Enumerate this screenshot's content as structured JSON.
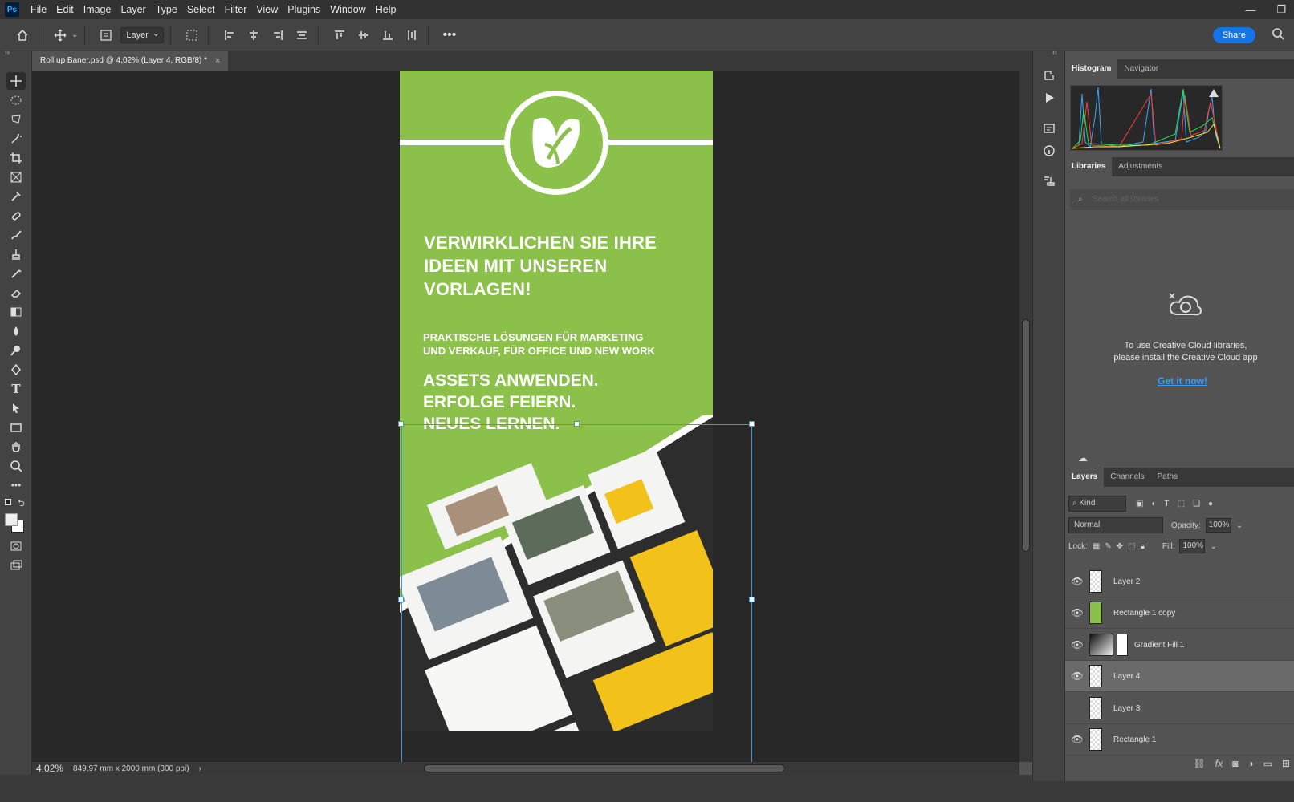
{
  "menu": {
    "app_logo": "Ps",
    "items": [
      "File",
      "Edit",
      "Image",
      "Layer",
      "Type",
      "Select",
      "Filter",
      "View",
      "Plugins",
      "Window",
      "Help"
    ]
  },
  "options": {
    "auto_select_target": "Layer",
    "share_label": "Share"
  },
  "document_tab": {
    "title": "Roll up Baner.psd @ 4,02% (Layer 4, RGB/8) *",
    "close": "×"
  },
  "artwork": {
    "headline": [
      "VERWIRKLICHEN SIE IHRE",
      "IDEEN MIT UNSEREN",
      "VORLAGEN!"
    ],
    "subline": [
      "PRAKTISCHE LÖSUNGEN FÜR MARKETING",
      "UND VERKAUF, FÜR OFFICE UND NEW WORK"
    ],
    "tagline": [
      "ASSETS ANWENDEN.",
      "ERFOLGE FEIERN.",
      "NEUES LERNEN."
    ],
    "colors": {
      "green": "#8bc04a",
      "yellow": "#f2c21b",
      "dark": "#2d2d2d"
    }
  },
  "status": {
    "zoom": "4,02%",
    "doc_size": "849,97 mm x 2000 mm (300 ppi)"
  },
  "panels": {
    "top_tabs": [
      "Histogram",
      "Navigator"
    ],
    "lib_tabs": [
      "Libraries",
      "Adjustments"
    ],
    "lib_search_placeholder": "Search all libraries",
    "lib_message": [
      "To use Creative Cloud libraries,",
      "please install the Creative Cloud app"
    ],
    "lib_link": "Get it now!",
    "layer_tabs": [
      "Layers",
      "Channels",
      "Paths"
    ],
    "kind": "Kind",
    "blend_mode": "Normal",
    "opacity_label": "Opacity:",
    "opacity_value": "100%",
    "lock_label": "Lock:",
    "fill_label": "Fill:",
    "fill_value": "100%"
  },
  "layers": [
    {
      "name": "Layer 2",
      "visible": true,
      "thumb": "checker"
    },
    {
      "name": "Rectangle 1 copy",
      "visible": true,
      "thumb": "green"
    },
    {
      "name": "Gradient Fill 1",
      "visible": true,
      "thumb": "gradient"
    },
    {
      "name": "Layer 4",
      "visible": true,
      "thumb": "checker",
      "selected": true
    },
    {
      "name": "Layer 3",
      "visible": false,
      "thumb": "checker"
    },
    {
      "name": "Rectangle 1",
      "visible": true,
      "thumb": "checker"
    }
  ]
}
